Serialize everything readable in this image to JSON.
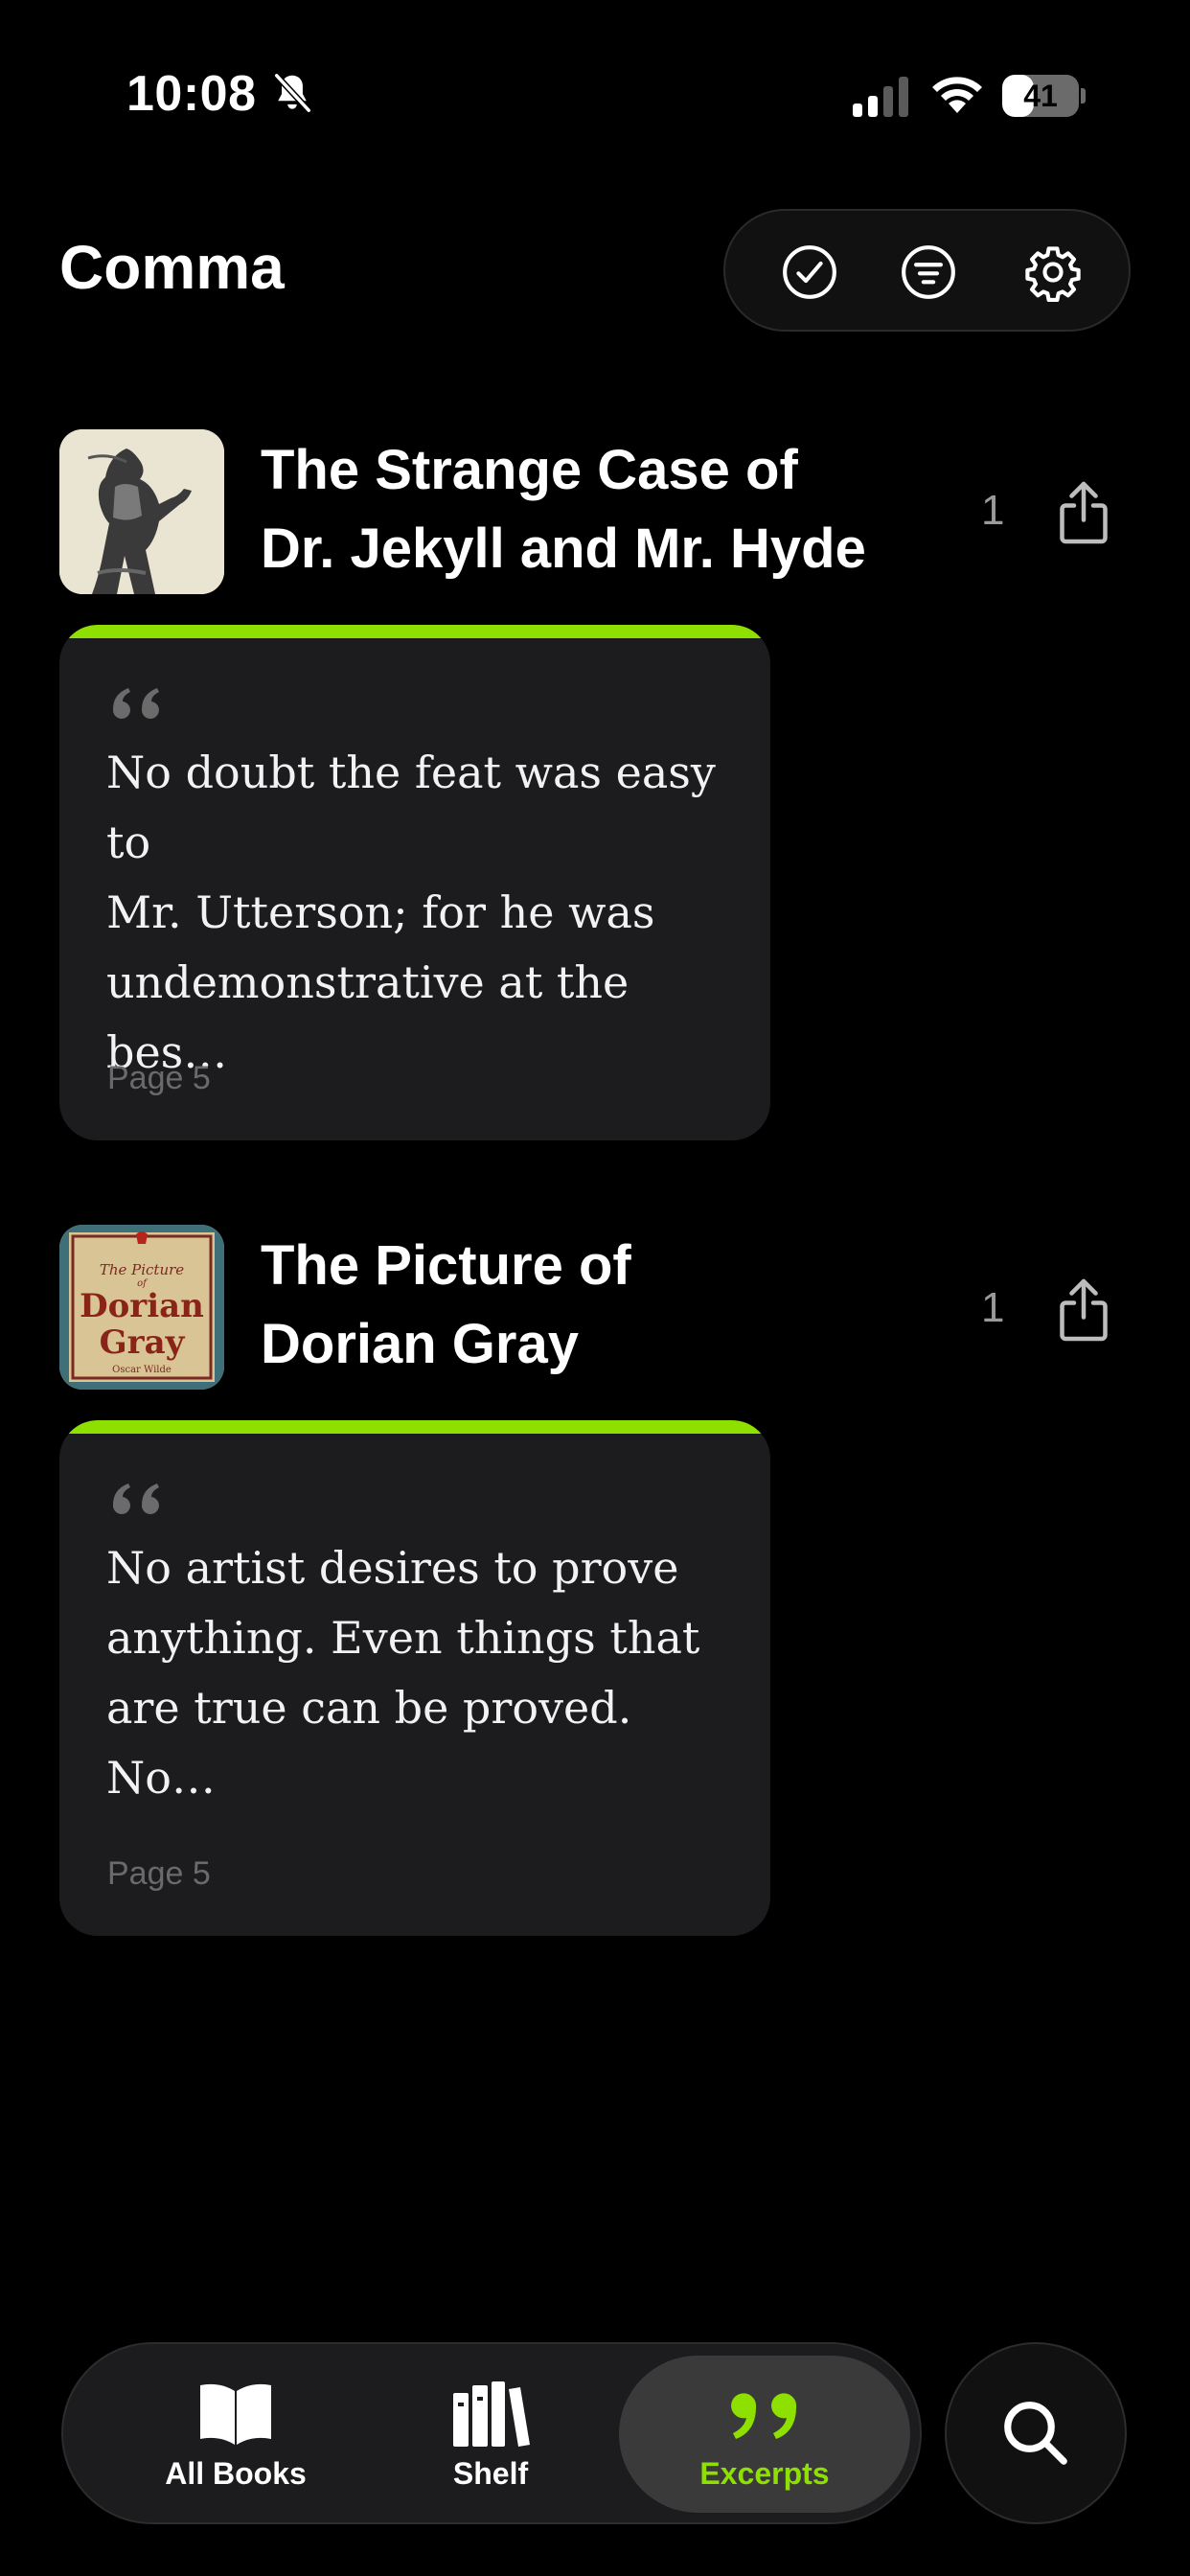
{
  "status_bar": {
    "time": "10:08",
    "battery_percent": "41",
    "battery_level": 0.41,
    "icons": [
      "bell-slash-icon",
      "cellular-signal-icon",
      "wifi-icon",
      "battery-icon"
    ]
  },
  "header": {
    "title": "Comma",
    "actions": [
      {
        "name": "select",
        "icon": "checkmark-circle-icon"
      },
      {
        "name": "filter",
        "icon": "filter-lines-icon"
      },
      {
        "name": "settings",
        "icon": "gear-icon"
      }
    ]
  },
  "books": [
    {
      "title_line1": "The Strange Case of",
      "title_line2": "Dr. Jekyll and Mr. Hyde",
      "count": "1",
      "excerpt_line1": "No doubt the feat was easy to",
      "excerpt_line2": "Mr. Utterson; for he was",
      "excerpt_line3": "undemonstrative at the bes…",
      "page": "Page 5",
      "accent_color": "#8ee000"
    },
    {
      "title_line1": "The Picture of",
      "title_line2": "Dorian Gray",
      "count": "1",
      "excerpt_line1": "No artist desires to prove",
      "excerpt_line2": "anything. Even things that",
      "excerpt_line3": "are true can be proved. No…",
      "page": "Page 5",
      "accent_color": "#8ee000",
      "cover_text": "The Picture of Dorian Gray Oscar Wilde"
    }
  ],
  "tab_bar": {
    "tabs": [
      {
        "label": "All Books",
        "icon": "open-book-icon",
        "active": false
      },
      {
        "label": "Shelf",
        "icon": "books-shelf-icon",
        "active": false
      },
      {
        "label": "Excerpts",
        "icon": "quote-icon",
        "active": true
      }
    ],
    "search_icon": "search-icon"
  },
  "colors": {
    "background": "#000000",
    "card": "#1c1c1e",
    "accent": "#8ee000",
    "muted_text": "#6a6a6a"
  }
}
